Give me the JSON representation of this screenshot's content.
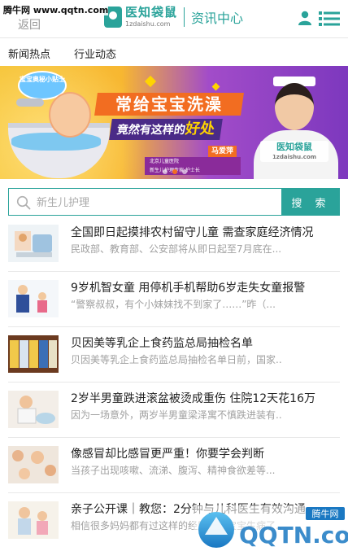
{
  "watermark_top": "腾牛网 www.qqtn.com",
  "header": {
    "back_label": "返回",
    "logo_name": "医知袋鼠",
    "logo_domain": "1zdaishu.com",
    "section_title": "资讯中心"
  },
  "tabs": [
    {
      "label": "新闻热点"
    },
    {
      "label": "行业动态"
    }
  ],
  "banner": {
    "tag": "宝宝奥秘小贴士",
    "headline": "常给宝宝洗澡",
    "subheadline_prefix": "竟然有这样的",
    "subheadline_highlight": "好处",
    "hospital_line1": "北京儿童医院",
    "hospital_line2": "新生儿护理专家 护士长",
    "nurse_name": "马爱萍",
    "logo_name": "医知袋鼠",
    "logo_domain": "1zdaishu.com",
    "slide_count": 3,
    "active_slide": 2
  },
  "search": {
    "placeholder": "新生儿护理",
    "button_label": "搜 索"
  },
  "news": [
    {
      "title": "全国即日起摸排农村留守儿童 需查家庭经济情况",
      "summary": "民政部、教育部、公安部将从即日起至7月底在..."
    },
    {
      "title": "9岁机智女童 用停机手机帮助6岁走失女童报警",
      "summary": "“警察叔叔，有个小妹妹找不到家了……”昨（..."
    },
    {
      "title": "贝因美等乳企上食药监总局抽检名单",
      "summary": "贝因美等乳企上食药监总局抽检名单日前，国家..."
    },
    {
      "title": "2岁半男童跌进滚盆被烫成重伤 住院12天花16万",
      "summary": "因为一场意外，两岁半男童梁泽寓不慎跌进装有..."
    },
    {
      "title": "像感冒却比感冒更严重！你要学会判断",
      "summary": "当孩子出现咳嗽、流涕、腹泻、精神食欲差等..."
    },
    {
      "title": "亲子公开课｜教您：2分钟与儿科医生有效沟通",
      "summary": "相信很多妈妈都有过这样的经历，当宝宝生病了..."
    }
  ],
  "watermark_bottom": {
    "site": "腾牛网",
    "brand": "QQTN.com"
  },
  "colors": {
    "accent": "#2aa39a",
    "banner_orange": "#f26d21",
    "banner_purple": "#4a2a87"
  }
}
